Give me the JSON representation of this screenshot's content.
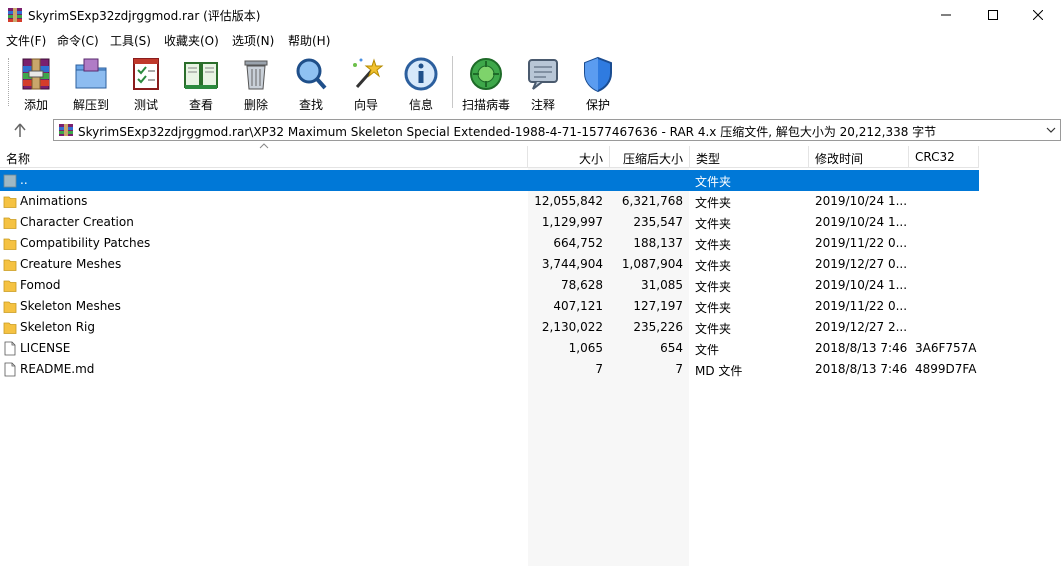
{
  "window": {
    "title": "SkyrimSExp32zdjrggmod.rar (评估版本)"
  },
  "menu": [
    "文件(F)",
    "命令(C)",
    "工具(S)",
    "收藏夹(O)",
    "选项(N)",
    "帮助(H)"
  ],
  "toolbar": {
    "add": "添加",
    "extract": "解压到",
    "test": "测试",
    "view": "查看",
    "delete": "删除",
    "find": "查找",
    "wizard": "向导",
    "info": "信息",
    "virus": "扫描病毒",
    "comment": "注释",
    "protect": "保护"
  },
  "address": {
    "path": "SkyrimSExp32zdjrggmod.rar\\XP32 Maximum Skeleton Special Extended-1988-4-71-1577467636 - RAR 4.x 压缩文件, 解包大小为 20,212,338 字节"
  },
  "columns": {
    "name": "名称",
    "size": "大小",
    "packed": "压缩后大小",
    "type": "类型",
    "modified": "修改时间",
    "crc": "CRC32"
  },
  "rows": [
    {
      "name": "..",
      "size": "",
      "packed": "",
      "type": "文件夹",
      "modified": "",
      "crc": "",
      "kind": "up"
    },
    {
      "name": "Animations",
      "size": "12,055,842",
      "packed": "6,321,768",
      "type": "文件夹",
      "modified": "2019/10/24 1...",
      "crc": "",
      "kind": "folder"
    },
    {
      "name": "Character Creation",
      "size": "1,129,997",
      "packed": "235,547",
      "type": "文件夹",
      "modified": "2019/10/24 1...",
      "crc": "",
      "kind": "folder"
    },
    {
      "name": "Compatibility Patches",
      "size": "664,752",
      "packed": "188,137",
      "type": "文件夹",
      "modified": "2019/11/22 0...",
      "crc": "",
      "kind": "folder"
    },
    {
      "name": "Creature Meshes",
      "size": "3,744,904",
      "packed": "1,087,904",
      "type": "文件夹",
      "modified": "2019/12/27 0...",
      "crc": "",
      "kind": "folder"
    },
    {
      "name": "Fomod",
      "size": "78,628",
      "packed": "31,085",
      "type": "文件夹",
      "modified": "2019/10/24 1...",
      "crc": "",
      "kind": "folder"
    },
    {
      "name": "Skeleton Meshes",
      "size": "407,121",
      "packed": "127,197",
      "type": "文件夹",
      "modified": "2019/11/22 0...",
      "crc": "",
      "kind": "folder"
    },
    {
      "name": "Skeleton Rig",
      "size": "2,130,022",
      "packed": "235,226",
      "type": "文件夹",
      "modified": "2019/12/27 2...",
      "crc": "",
      "kind": "folder"
    },
    {
      "name": "LICENSE",
      "size": "1,065",
      "packed": "654",
      "type": "文件",
      "modified": "2018/8/13 7:46",
      "crc": "3A6F757A",
      "kind": "file"
    },
    {
      "name": "README.md",
      "size": "7",
      "packed": "7",
      "type": "MD 文件",
      "modified": "2018/8/13 7:46",
      "crc": "4899D7FA",
      "kind": "file"
    }
  ],
  "colors": {
    "selection": "#0078d7",
    "folder": "#f5c242"
  }
}
